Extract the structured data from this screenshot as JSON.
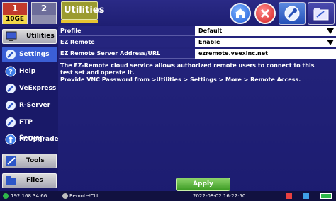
{
  "ports": [
    {
      "number": "1",
      "label": "10GE"
    },
    {
      "number": "2",
      "label": ""
    }
  ],
  "header": {
    "title": "Utilities"
  },
  "sidebar": {
    "utilities_label": "Utilities",
    "items": [
      {
        "label": "Settings"
      },
      {
        "label": "Help"
      },
      {
        "label": "VeExpress"
      },
      {
        "label": "R-Server"
      },
      {
        "label": "FTP Server"
      },
      {
        "label": "M.Upgrade"
      }
    ],
    "tools_label": "Tools",
    "files_label": "Files"
  },
  "settings_table": {
    "rows": [
      {
        "key": "Profile",
        "value": "Default"
      },
      {
        "key": "EZ Remote",
        "value": "Enable"
      },
      {
        "key": "EZ Remote Server Address/URL",
        "value": "ezremote.veexinc.net"
      }
    ]
  },
  "description": {
    "line1": "The EZ-Remote cloud service allows authorized remote users to connect to this",
    "line2": "test set and operate it.",
    "line3": "Provide VNC Password from >Utilities > Settings > More > Remote Access."
  },
  "apply_label": "Apply",
  "status": {
    "ip": "192.168.34.66",
    "remote": "Remote/CLI",
    "datetime": "2022-08-02  16:22:50"
  },
  "colors": {
    "background": "#1c1c70",
    "active_item": "#3b5fd6",
    "apply_button": "#4caf2a",
    "title_box": "#9b9b30"
  }
}
